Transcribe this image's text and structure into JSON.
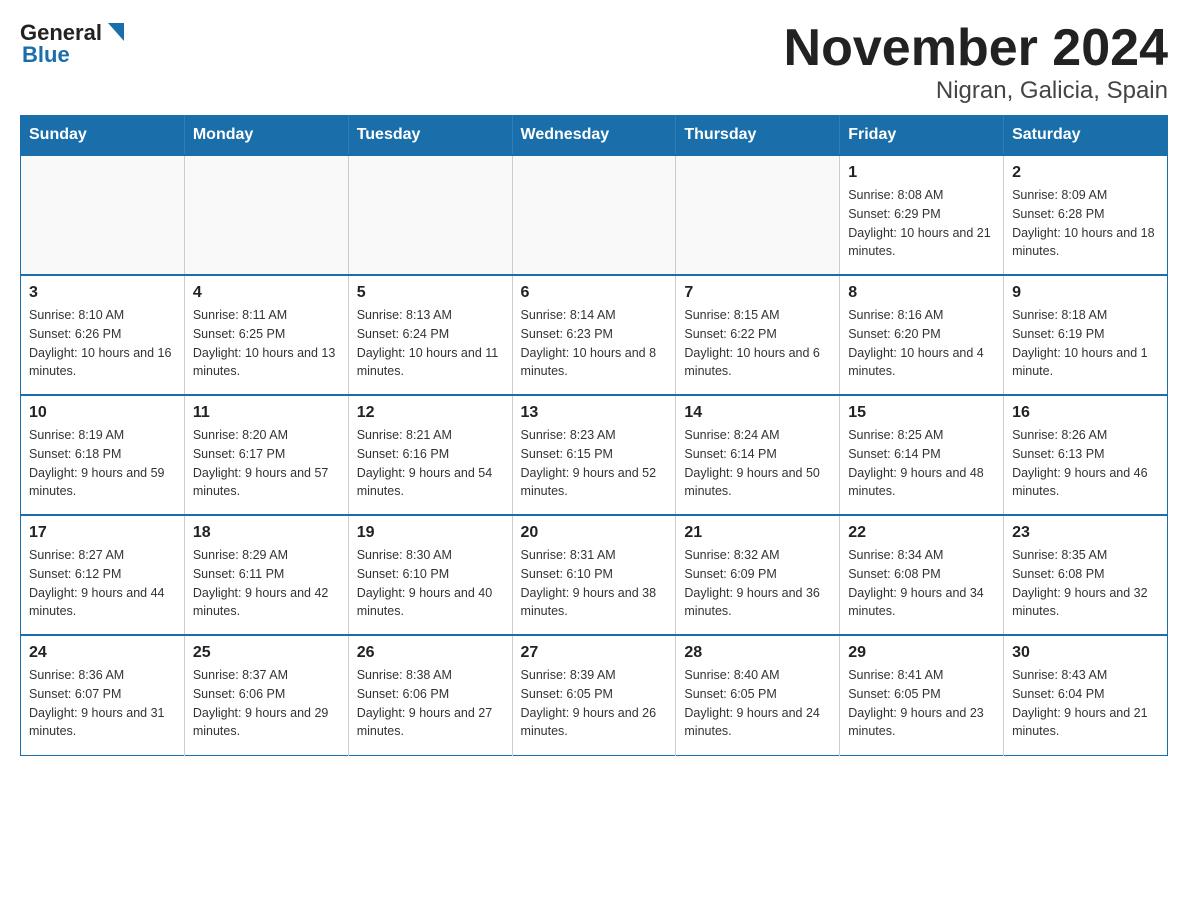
{
  "header": {
    "title": "November 2024",
    "subtitle": "Nigran, Galicia, Spain",
    "logo_general": "General",
    "logo_blue": "Blue"
  },
  "days_of_week": [
    "Sunday",
    "Monday",
    "Tuesday",
    "Wednesday",
    "Thursday",
    "Friday",
    "Saturday"
  ],
  "weeks": [
    [
      {
        "day": "",
        "sunrise": "",
        "sunset": "",
        "daylight": ""
      },
      {
        "day": "",
        "sunrise": "",
        "sunset": "",
        "daylight": ""
      },
      {
        "day": "",
        "sunrise": "",
        "sunset": "",
        "daylight": ""
      },
      {
        "day": "",
        "sunrise": "",
        "sunset": "",
        "daylight": ""
      },
      {
        "day": "",
        "sunrise": "",
        "sunset": "",
        "daylight": ""
      },
      {
        "day": "1",
        "sunrise": "Sunrise: 8:08 AM",
        "sunset": "Sunset: 6:29 PM",
        "daylight": "Daylight: 10 hours and 21 minutes."
      },
      {
        "day": "2",
        "sunrise": "Sunrise: 8:09 AM",
        "sunset": "Sunset: 6:28 PM",
        "daylight": "Daylight: 10 hours and 18 minutes."
      }
    ],
    [
      {
        "day": "3",
        "sunrise": "Sunrise: 8:10 AM",
        "sunset": "Sunset: 6:26 PM",
        "daylight": "Daylight: 10 hours and 16 minutes."
      },
      {
        "day": "4",
        "sunrise": "Sunrise: 8:11 AM",
        "sunset": "Sunset: 6:25 PM",
        "daylight": "Daylight: 10 hours and 13 minutes."
      },
      {
        "day": "5",
        "sunrise": "Sunrise: 8:13 AM",
        "sunset": "Sunset: 6:24 PM",
        "daylight": "Daylight: 10 hours and 11 minutes."
      },
      {
        "day": "6",
        "sunrise": "Sunrise: 8:14 AM",
        "sunset": "Sunset: 6:23 PM",
        "daylight": "Daylight: 10 hours and 8 minutes."
      },
      {
        "day": "7",
        "sunrise": "Sunrise: 8:15 AM",
        "sunset": "Sunset: 6:22 PM",
        "daylight": "Daylight: 10 hours and 6 minutes."
      },
      {
        "day": "8",
        "sunrise": "Sunrise: 8:16 AM",
        "sunset": "Sunset: 6:20 PM",
        "daylight": "Daylight: 10 hours and 4 minutes."
      },
      {
        "day": "9",
        "sunrise": "Sunrise: 8:18 AM",
        "sunset": "Sunset: 6:19 PM",
        "daylight": "Daylight: 10 hours and 1 minute."
      }
    ],
    [
      {
        "day": "10",
        "sunrise": "Sunrise: 8:19 AM",
        "sunset": "Sunset: 6:18 PM",
        "daylight": "Daylight: 9 hours and 59 minutes."
      },
      {
        "day": "11",
        "sunrise": "Sunrise: 8:20 AM",
        "sunset": "Sunset: 6:17 PM",
        "daylight": "Daylight: 9 hours and 57 minutes."
      },
      {
        "day": "12",
        "sunrise": "Sunrise: 8:21 AM",
        "sunset": "Sunset: 6:16 PM",
        "daylight": "Daylight: 9 hours and 54 minutes."
      },
      {
        "day": "13",
        "sunrise": "Sunrise: 8:23 AM",
        "sunset": "Sunset: 6:15 PM",
        "daylight": "Daylight: 9 hours and 52 minutes."
      },
      {
        "day": "14",
        "sunrise": "Sunrise: 8:24 AM",
        "sunset": "Sunset: 6:14 PM",
        "daylight": "Daylight: 9 hours and 50 minutes."
      },
      {
        "day": "15",
        "sunrise": "Sunrise: 8:25 AM",
        "sunset": "Sunset: 6:14 PM",
        "daylight": "Daylight: 9 hours and 48 minutes."
      },
      {
        "day": "16",
        "sunrise": "Sunrise: 8:26 AM",
        "sunset": "Sunset: 6:13 PM",
        "daylight": "Daylight: 9 hours and 46 minutes."
      }
    ],
    [
      {
        "day": "17",
        "sunrise": "Sunrise: 8:27 AM",
        "sunset": "Sunset: 6:12 PM",
        "daylight": "Daylight: 9 hours and 44 minutes."
      },
      {
        "day": "18",
        "sunrise": "Sunrise: 8:29 AM",
        "sunset": "Sunset: 6:11 PM",
        "daylight": "Daylight: 9 hours and 42 minutes."
      },
      {
        "day": "19",
        "sunrise": "Sunrise: 8:30 AM",
        "sunset": "Sunset: 6:10 PM",
        "daylight": "Daylight: 9 hours and 40 minutes."
      },
      {
        "day": "20",
        "sunrise": "Sunrise: 8:31 AM",
        "sunset": "Sunset: 6:10 PM",
        "daylight": "Daylight: 9 hours and 38 minutes."
      },
      {
        "day": "21",
        "sunrise": "Sunrise: 8:32 AM",
        "sunset": "Sunset: 6:09 PM",
        "daylight": "Daylight: 9 hours and 36 minutes."
      },
      {
        "day": "22",
        "sunrise": "Sunrise: 8:34 AM",
        "sunset": "Sunset: 6:08 PM",
        "daylight": "Daylight: 9 hours and 34 minutes."
      },
      {
        "day": "23",
        "sunrise": "Sunrise: 8:35 AM",
        "sunset": "Sunset: 6:08 PM",
        "daylight": "Daylight: 9 hours and 32 minutes."
      }
    ],
    [
      {
        "day": "24",
        "sunrise": "Sunrise: 8:36 AM",
        "sunset": "Sunset: 6:07 PM",
        "daylight": "Daylight: 9 hours and 31 minutes."
      },
      {
        "day": "25",
        "sunrise": "Sunrise: 8:37 AM",
        "sunset": "Sunset: 6:06 PM",
        "daylight": "Daylight: 9 hours and 29 minutes."
      },
      {
        "day": "26",
        "sunrise": "Sunrise: 8:38 AM",
        "sunset": "Sunset: 6:06 PM",
        "daylight": "Daylight: 9 hours and 27 minutes."
      },
      {
        "day": "27",
        "sunrise": "Sunrise: 8:39 AM",
        "sunset": "Sunset: 6:05 PM",
        "daylight": "Daylight: 9 hours and 26 minutes."
      },
      {
        "day": "28",
        "sunrise": "Sunrise: 8:40 AM",
        "sunset": "Sunset: 6:05 PM",
        "daylight": "Daylight: 9 hours and 24 minutes."
      },
      {
        "day": "29",
        "sunrise": "Sunrise: 8:41 AM",
        "sunset": "Sunset: 6:05 PM",
        "daylight": "Daylight: 9 hours and 23 minutes."
      },
      {
        "day": "30",
        "sunrise": "Sunrise: 8:43 AM",
        "sunset": "Sunset: 6:04 PM",
        "daylight": "Daylight: 9 hours and 21 minutes."
      }
    ]
  ]
}
